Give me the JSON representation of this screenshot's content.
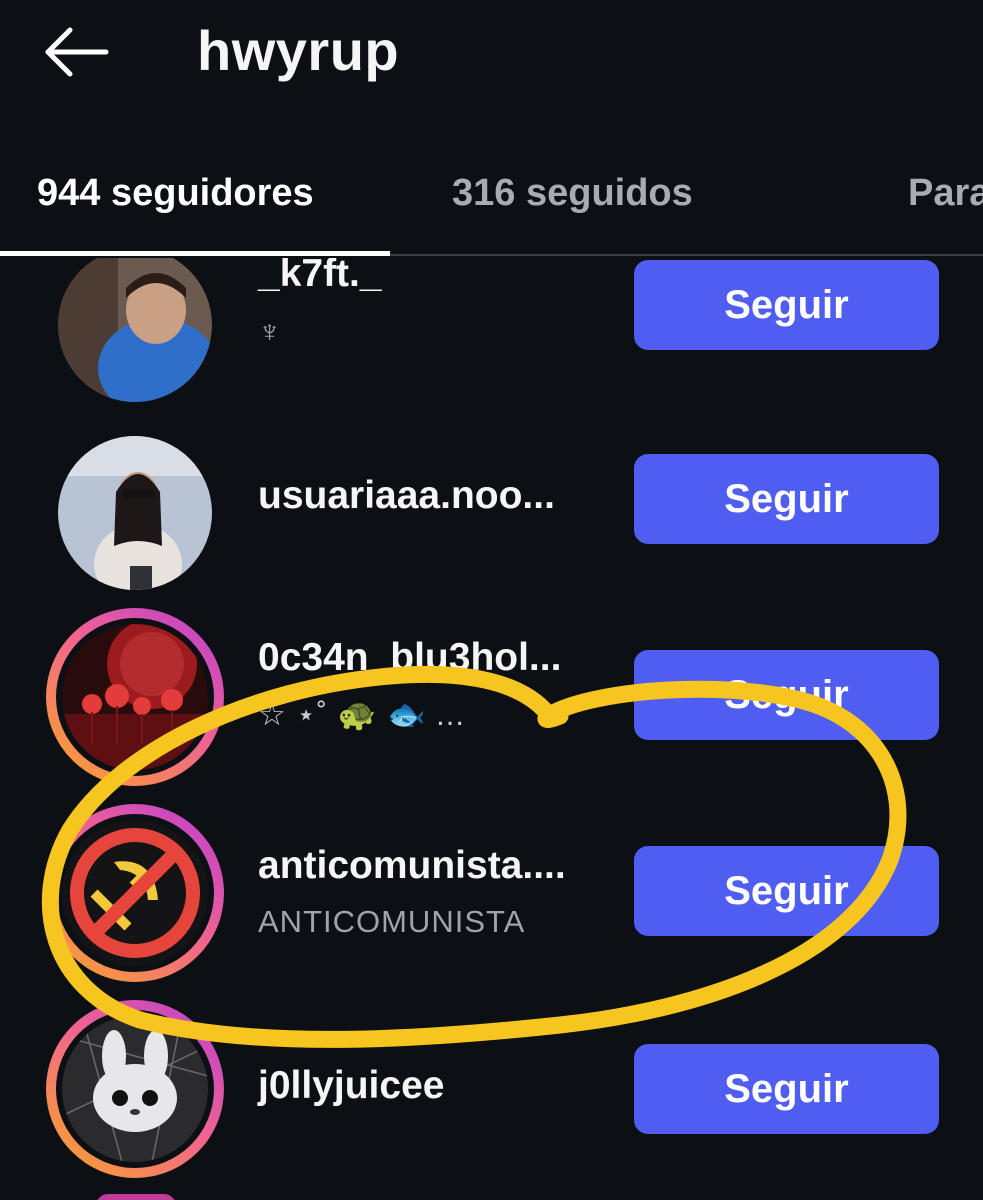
{
  "header": {
    "title": "hwyrup",
    "back_icon": "arrow-left-icon"
  },
  "tabs": [
    {
      "label": "944 seguidores",
      "active": true
    },
    {
      "label": "316 seguidos",
      "active": false
    },
    {
      "label": "Para",
      "active": false
    }
  ],
  "followers": [
    {
      "username": "_k7ft._",
      "subtitle": "♆",
      "button": "Seguir",
      "story_ring": false
    },
    {
      "username": "usuariaaa.noo...",
      "subtitle": "",
      "button": "Seguir",
      "story_ring": false
    },
    {
      "username": "0c34n_blu3hol...",
      "subtitle": "☆ ⋆˚ 🐢 🐟 ...",
      "button": "Seguir",
      "story_ring": true
    },
    {
      "username": "anticomunista....",
      "subtitle": "ANTICOMUNISTA",
      "button": "Seguir",
      "story_ring": true
    },
    {
      "username": "j0llyjuicee",
      "subtitle": "",
      "button": "Seguir",
      "story_ring": true
    }
  ],
  "colors": {
    "background": "#0c0f14",
    "button": "#4f5ef0",
    "annotation": "#f7c51f"
  }
}
